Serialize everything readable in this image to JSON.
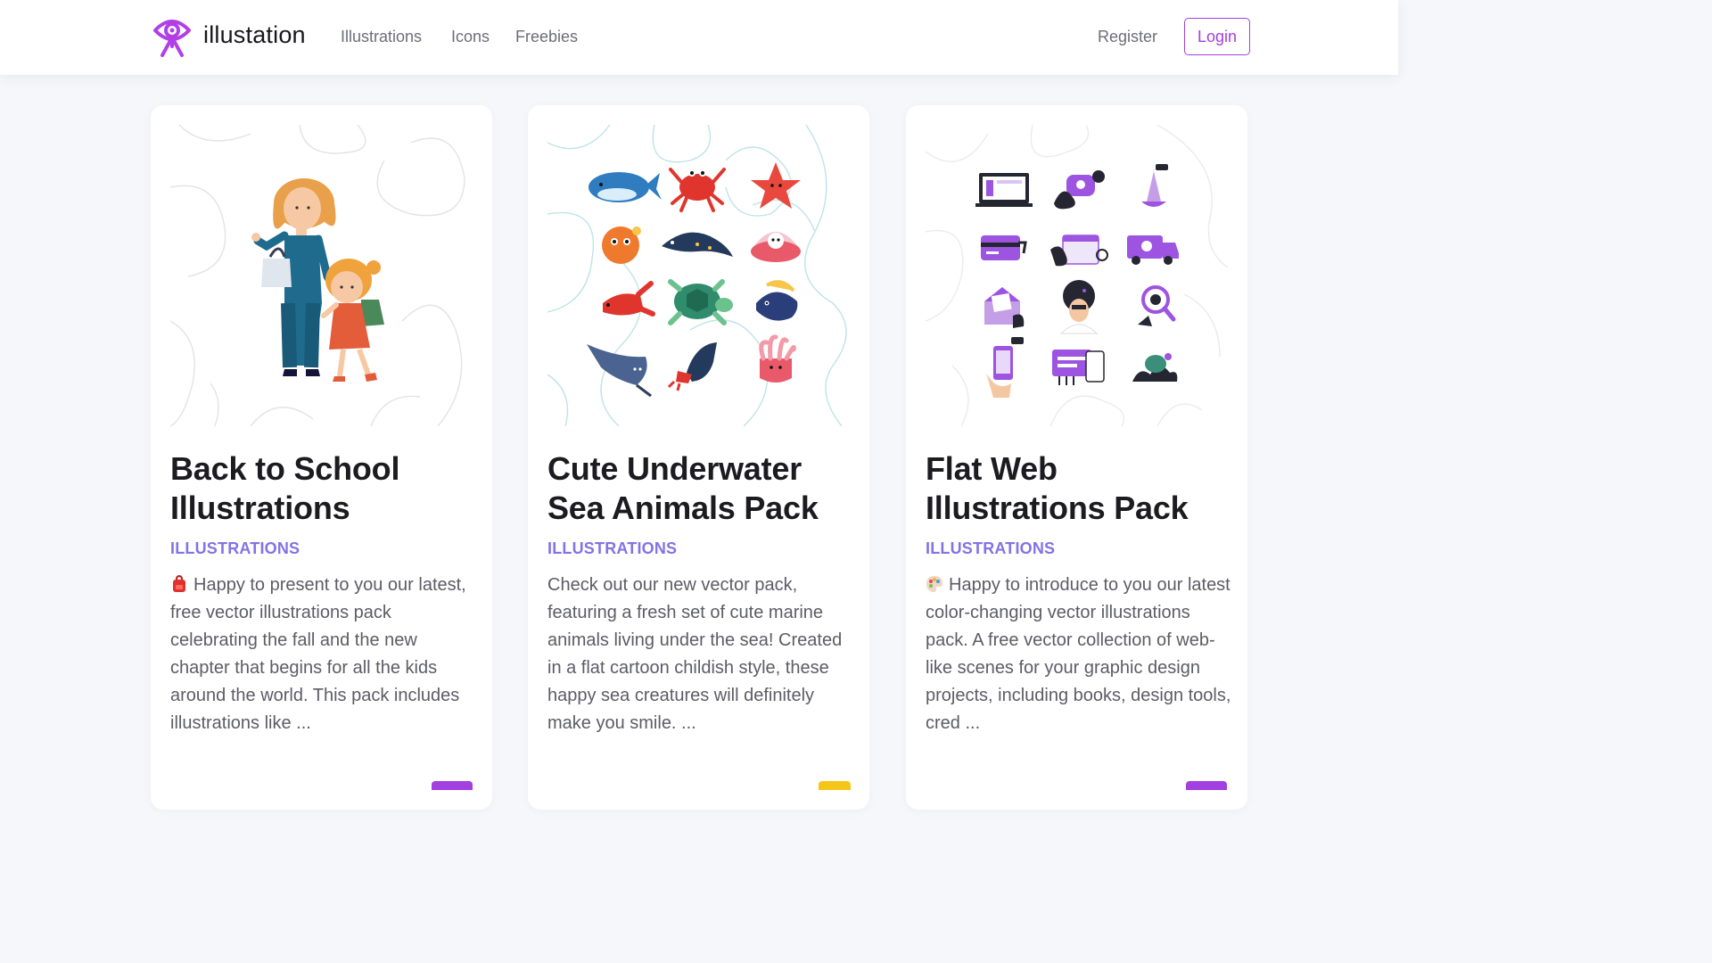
{
  "header": {
    "brand": "illustation",
    "nav": [
      "Illustrations",
      "Icons",
      "Freebies"
    ],
    "register_label": "Register",
    "login_label": "Login",
    "logo_icon": "eye-pin-logo-icon",
    "accent_color": "#a23fe0"
  },
  "cards": [
    {
      "title": "Back to School Illustrations",
      "category": "ILLUSTRATIONS",
      "description": "Happy to present to you our latest, free vector illustrations pack celebrating the fall and the new chapter that begins for all the kids around the world. This pack includes illustrations like ...",
      "emoji_icon": "backpack-icon",
      "tag_color": "#a23fe0"
    },
    {
      "title": "Cute Underwater Sea Animals Pack",
      "category": "ILLUSTRATIONS",
      "description": "Check out our new vector pack, featuring a fresh set of cute marine animals living under the sea! Created in a flat cartoon childish style, these happy sea creatures will definitely make you smile. ...",
      "tag_color": "#f5c518"
    },
    {
      "title": "Flat Web Illustrations Pack",
      "category": "ILLUSTRATIONS",
      "description": "Happy to introduce to you our latest color-changing vector illustrations pack. A free vector collection of web-like scenes for your graphic design projects, including books, design tools, cred ...",
      "emoji_icon": "palette-icon",
      "tag_color": "#a23fe0"
    }
  ]
}
